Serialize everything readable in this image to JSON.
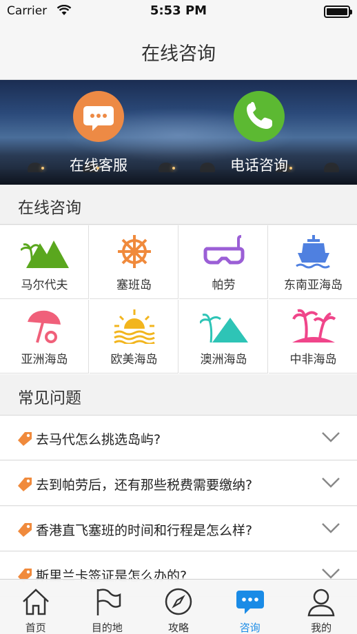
{
  "status_bar": {
    "carrier": "Carrier",
    "time": "5:53 PM"
  },
  "nav": {
    "title": "在线咨询"
  },
  "banner": {
    "online_service_label": "在线客服",
    "phone_consult_label": "电话咨询"
  },
  "sections": {
    "consult_title": "在线咨询",
    "faq_title": "常见问题"
  },
  "destinations": [
    {
      "label": "马尔代夫",
      "icon": "maldives-mountain-palm-icon",
      "color": "#5aa71e"
    },
    {
      "label": "塞班岛",
      "icon": "ship-wheel-icon",
      "color": "#f08a3c"
    },
    {
      "label": "帕劳",
      "icon": "diving-mask-icon",
      "color": "#9b5fd6"
    },
    {
      "label": "东南亚海岛",
      "icon": "ship-icon",
      "color": "#4f80e0"
    },
    {
      "label": "亚洲海岛",
      "icon": "beach-umbrella-icon",
      "color": "#f0607a"
    },
    {
      "label": "欧美海岛",
      "icon": "sunset-icon",
      "color": "#f2b51e"
    },
    {
      "label": "澳洲海岛",
      "icon": "palm-mountain-icon",
      "color": "#2ec4b6"
    },
    {
      "label": "中非海岛",
      "icon": "palm-island-icon",
      "color": "#f0458a"
    }
  ],
  "faq": [
    {
      "question": "去马代怎么挑选岛屿?"
    },
    {
      "question": "去到帕劳后，还有那些税费需要缴纳?"
    },
    {
      "question": "香港直飞塞班的时间和行程是怎么样?"
    },
    {
      "question": "斯里兰卡签证是怎么办的?"
    }
  ],
  "tabs": [
    {
      "label": "首页",
      "icon": "home-icon"
    },
    {
      "label": "目的地",
      "icon": "flag-icon"
    },
    {
      "label": "攻略",
      "icon": "compass-icon"
    },
    {
      "label": "咨询",
      "icon": "chat-bubble-icon",
      "active": true
    },
    {
      "label": "我的",
      "icon": "user-icon"
    }
  ],
  "colors": {
    "accent": "#1a8be6",
    "online_service": "#ed8a45",
    "phone": "#5cb932",
    "tag": "#f08a3c"
  }
}
